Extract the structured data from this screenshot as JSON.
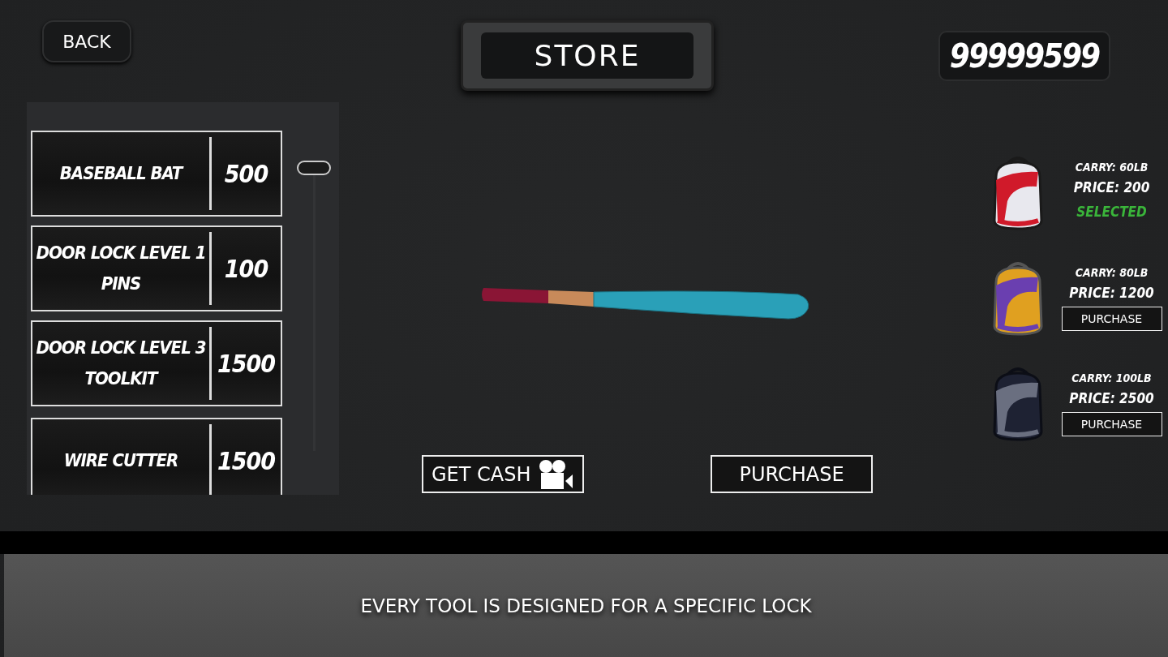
{
  "header": {
    "back": "BACK",
    "title": "STORE",
    "cash": "99999599"
  },
  "items": [
    {
      "name": "BASEBALL BAT",
      "price": "500"
    },
    {
      "name": "DOOR LOCK LEVEL 1 PINS",
      "price": "100"
    },
    {
      "name": "DOOR LOCK LEVEL 3 TOOLKIT",
      "price": "1500"
    },
    {
      "name": "WIRE CUTTER",
      "price": "1500"
    }
  ],
  "actions": {
    "get_cash": "GET CASH",
    "purchase": "PURCHASE"
  },
  "backpacks": [
    {
      "carry": "CARRY: 60LB",
      "price": "PRICE: 200",
      "selected": true,
      "status": "SELECTED"
    },
    {
      "carry": "CARRY: 80LB",
      "price": "PRICE: 1200",
      "selected": false,
      "status": "PURCHASE"
    },
    {
      "carry": "CARRY: 100LB",
      "price": "PRICE: 2500",
      "selected": false,
      "status": "PURCHASE"
    }
  ],
  "hint": "EVERY TOOL IS DESIGNED FOR A SPECIFIC LOCK"
}
